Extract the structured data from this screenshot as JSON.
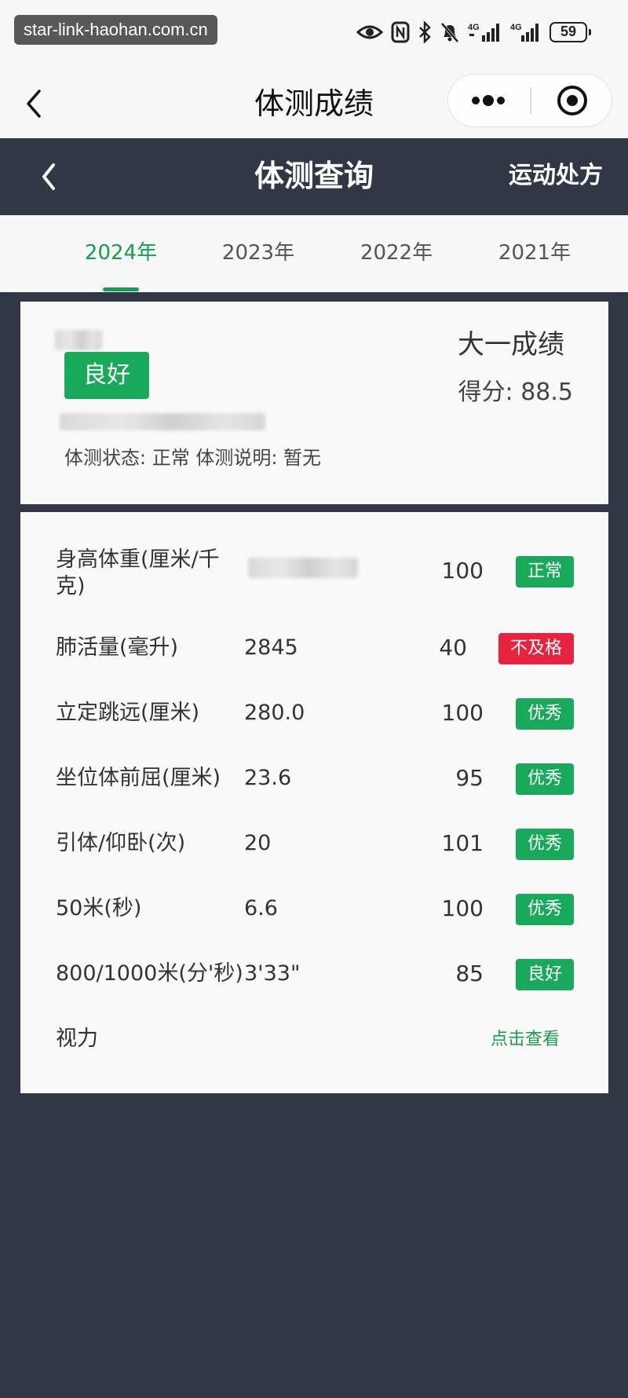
{
  "status_bar": {
    "watermark": "star-link-haohan.com.cn",
    "battery": "59",
    "icons": [
      "eye-icon",
      "nfc-icon",
      "bluetooth-icon",
      "mute-bell-icon",
      "signal-4g-icon",
      "signal-4g-icon",
      "battery-icon"
    ]
  },
  "nav": {
    "title": "体测成绩"
  },
  "header": {
    "title": "体测查询",
    "right_label": "运动处方"
  },
  "tabs": [
    {
      "label": "2024年",
      "active": true
    },
    {
      "label": "2023年",
      "active": false
    },
    {
      "label": "2022年",
      "active": false
    },
    {
      "label": "2021年",
      "active": false
    }
  ],
  "summary": {
    "grade": "良好",
    "level": "大一成绩",
    "score_label": "得分:",
    "score": "88.5",
    "status_text": "体测状态: 正常 体测说明: 暂无"
  },
  "results": [
    {
      "name": "身高体重(厘米/千克)",
      "value": "",
      "score": "100",
      "badge": "正常",
      "badge_color": "#18a95a"
    },
    {
      "name": "肺活量(毫升)",
      "value": "2845",
      "score": "40",
      "badge": "不及格",
      "badge_color": "#e8233f"
    },
    {
      "name": "立定跳远(厘米)",
      "value": "280.0",
      "score": "100",
      "badge": "优秀",
      "badge_color": "#18a95a"
    },
    {
      "name": "坐位体前屈(厘米)",
      "value": "23.6",
      "score": "95",
      "badge": "优秀",
      "badge_color": "#18a95a"
    },
    {
      "name": "引体/仰卧(次)",
      "value": "20",
      "score": "101",
      "badge": "优秀",
      "badge_color": "#18a95a"
    },
    {
      "name": "50米(秒)",
      "value": "6.6",
      "score": "100",
      "badge": "优秀",
      "badge_color": "#18a95a"
    },
    {
      "name": "800/1000米(分'秒)",
      "value": "3'33\"",
      "score": "85",
      "badge": "良好",
      "badge_color": "#18a95a"
    }
  ],
  "vision": {
    "name": "视力",
    "link": "点击查看"
  },
  "colors": {
    "accent_green": "#1a9b52",
    "badge_green": "#18a95a",
    "badge_red": "#e8233f",
    "dark_header": "#323746"
  }
}
